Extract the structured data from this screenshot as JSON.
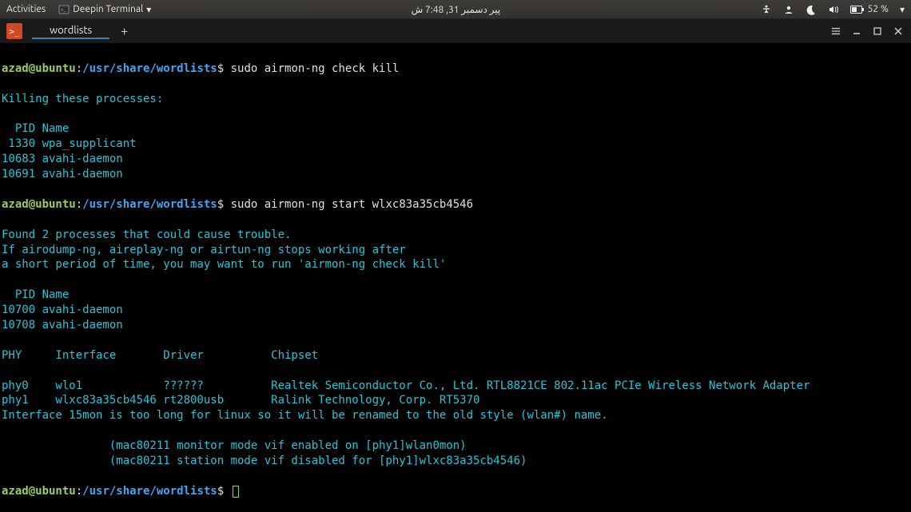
{
  "topbar": {
    "activities": "Activities",
    "app_name": "Deepin Terminal",
    "clock": "پیر دسمبر 31, 7:48 ش",
    "battery": "52 %"
  },
  "tabs": {
    "active_label": "wordlists",
    "add": "+"
  },
  "prompt_user": "azad@ubuntu",
  "prompt_sep": ":",
  "prompt_path": "/usr/share/wordlists",
  "prompt_dollar": "$",
  "lines": {
    "cmd1": " sudo airmon-ng check kill",
    "l1": "Killing these processes:",
    "l2": "  PID Name",
    "l3": " 1330 wpa_supplicant",
    "l4": "10683 avahi-daemon",
    "l5": "10691 avahi-daemon",
    "cmd2": " sudo airmon-ng start wlxc83a35cb4546",
    "l6": "Found 2 processes that could cause trouble.",
    "l7": "If airodump-ng, aireplay-ng or airtun-ng stops working after",
    "l8": "a short period of time, you may want to run 'airmon-ng check kill'",
    "l9": "  PID Name",
    "l10": "10700 avahi-daemon",
    "l11": "10708 avahi-daemon",
    "l12": "PHY     Interface       Driver          Chipset",
    "l13": "phy0    wlo1            ??????          Realtek Semiconductor Co., Ltd. RTL8821CE 802.11ac PCIe Wireless Network Adapter",
    "l14": "phy1    wlxc83a35cb4546 rt2800usb       Ralink Technology, Corp. RT5370",
    "l15": "Interface 15mon is too long for linux so it will be renamed to the old style (wlan#) name.",
    "l16": "                (mac80211 monitor mode vif enabled on [phy1]wlan0mon)",
    "l17": "                (mac80211 station mode vif disabled for [phy1]wlxc83a35cb4546)"
  }
}
